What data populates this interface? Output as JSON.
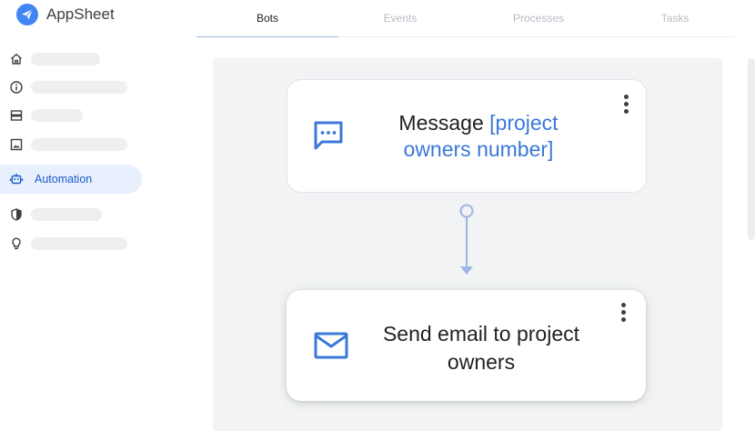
{
  "app": {
    "name": "AppSheet"
  },
  "tabs": [
    {
      "label": "Bots",
      "active": true
    },
    {
      "label": "Events",
      "active": false
    },
    {
      "label": "Processes",
      "active": false
    },
    {
      "label": "Tasks",
      "active": false
    }
  ],
  "sidebar": {
    "active_label": "Automation",
    "items": [
      {
        "icon": "home-icon"
      },
      {
        "icon": "info-icon"
      },
      {
        "icon": "data-icon"
      },
      {
        "icon": "image-icon"
      },
      {
        "icon": "robot-icon"
      },
      {
        "icon": "shield-icon"
      },
      {
        "icon": "lightbulb-icon"
      }
    ]
  },
  "steps": [
    {
      "icon": "message-icon",
      "title_prefix": "Message ",
      "title_highlight": "[project owners number]"
    },
    {
      "icon": "email-icon",
      "title": "Send email to project owners"
    }
  ],
  "colors": {
    "accent": "#3b78d8",
    "active_bg": "#e8f0fe",
    "canvas_bg": "#f1f3f4"
  }
}
